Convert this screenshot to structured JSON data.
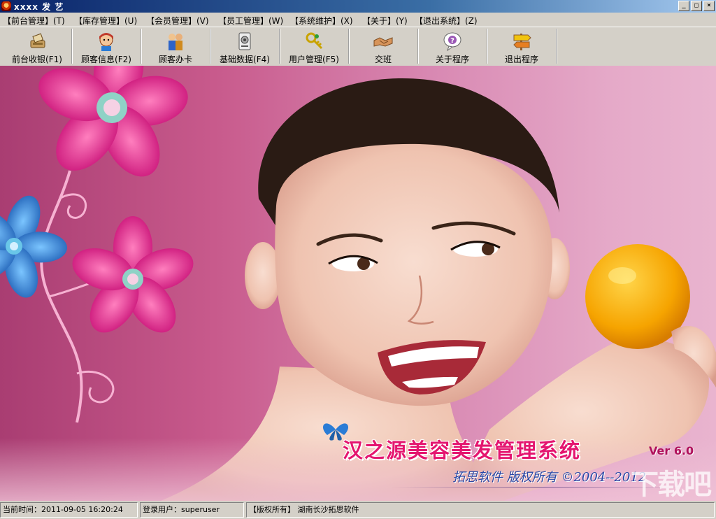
{
  "window": {
    "title": "xxxx 发 艺",
    "controls": [
      "_",
      "□",
      "×"
    ]
  },
  "menu": [
    {
      "label": "【前台管理】(T)"
    },
    {
      "label": "【库存管理】(U)"
    },
    {
      "label": "【会员管理】(V)"
    },
    {
      "label": "【员工管理】(W)"
    },
    {
      "label": "【系统维护】(X)"
    },
    {
      "label": "【关于】(Y)"
    },
    {
      "label": "【退出系统】(Z)"
    }
  ],
  "toolbar": [
    {
      "label": "前台收银(F1)",
      "icon": "cash-register-icon"
    },
    {
      "label": "顾客信息(F2)",
      "icon": "customer-info-icon"
    },
    {
      "label": "顾客办卡",
      "icon": "member-card-icon"
    },
    {
      "label": "基础数据(F4)",
      "icon": "database-icon"
    },
    {
      "label": "用户管理(F5)",
      "icon": "key-icon"
    },
    {
      "label": "交班",
      "icon": "handshake-icon"
    },
    {
      "label": "关于程序",
      "icon": "help-icon"
    },
    {
      "label": "退出程序",
      "icon": "exit-icon"
    }
  ],
  "banner": {
    "title": "汉之源美容美发管理系统",
    "version": "Ver 6.0",
    "subtitle": "拓思软件  版权所有  ©2004--2012",
    "watermark": "下载吧"
  },
  "status": {
    "time": "当前时间：2011-09-05 16:20:24",
    "user": "登录用户：superuser",
    "copyright": "【版权所有】 湖南长沙拓思软件"
  },
  "colors": {
    "accent": "#e4156f",
    "subtitle": "#2747a6",
    "background_left": "#a93d72",
    "background_right": "#e9b4cf"
  }
}
